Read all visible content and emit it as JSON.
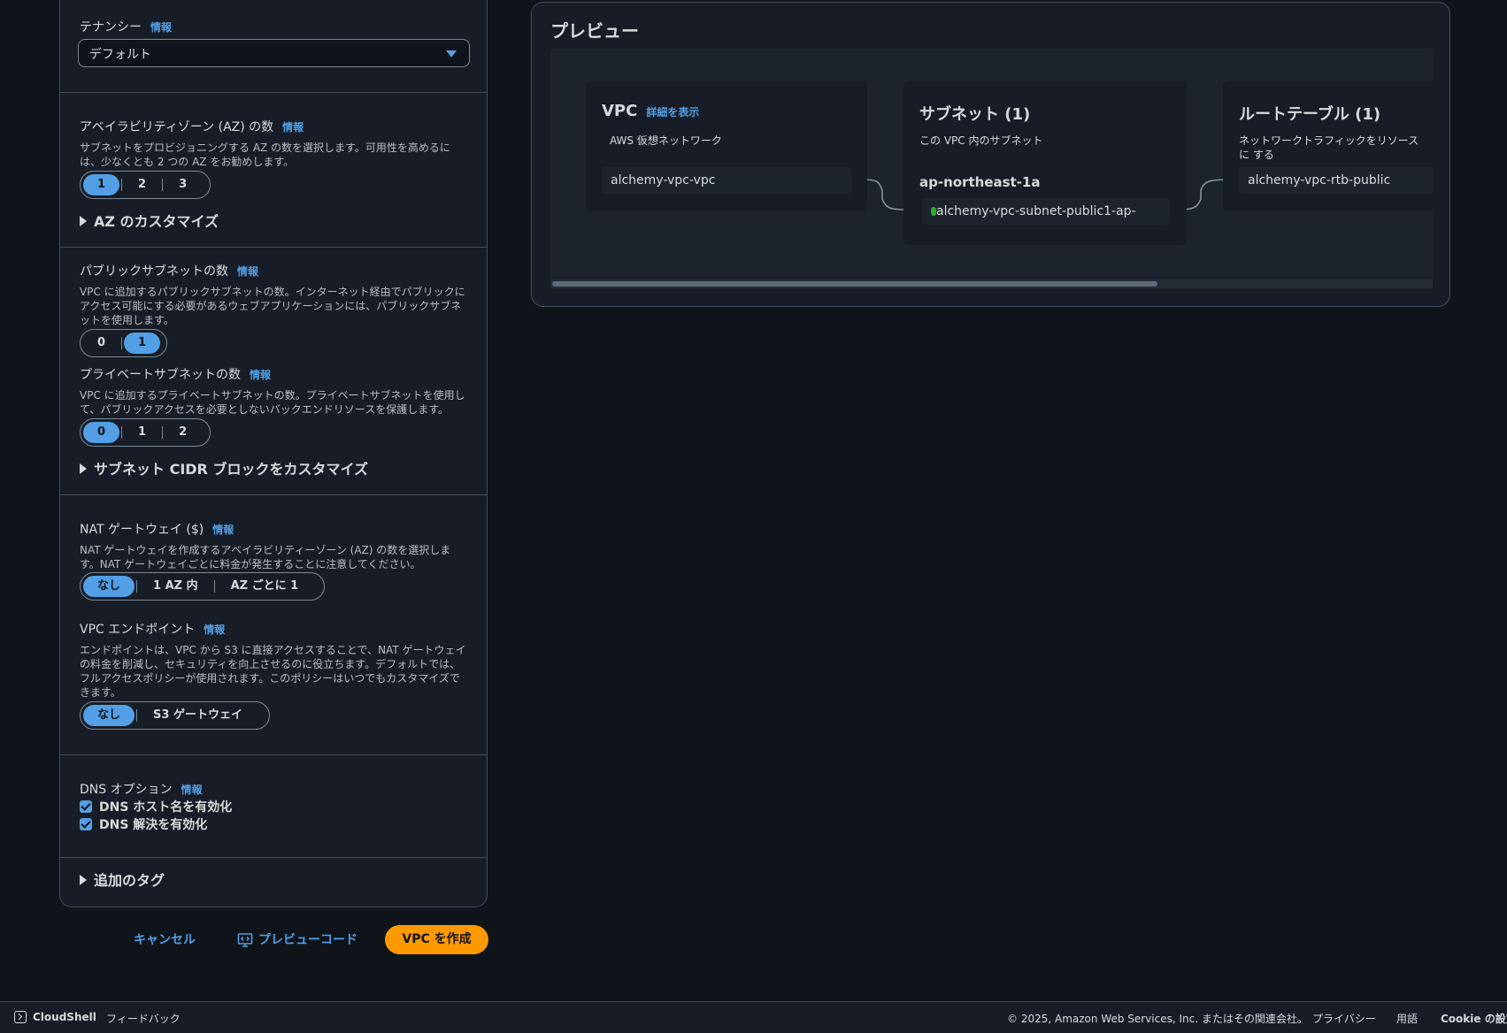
{
  "tenancy": {
    "label": "テナンシー",
    "info": "情報",
    "value": "デフォルト"
  },
  "az_count": {
    "label_prefix": "アベイラビリティゾーン (AZ) ",
    "label_suffix": "の数",
    "info": "情報",
    "description": "サブネットをプロビジョニングする AZ の数を選択します。可用性を高めるには、少なくとも 2 つの AZ をお勧めします。",
    "options": [
      "1",
      "2",
      "3"
    ],
    "selected": "1",
    "customize": "AZ のカスタマイズ"
  },
  "public_subnets": {
    "label": "パブリックサブネットの数",
    "info": "情報",
    "description": "VPC に追加するパブリックサブネットの数。インターネット経由でパブリックにアクセス可能にする必要があるウェブアプリケーションには、パブリックサブネットを使用します。",
    "options": [
      "0",
      "1"
    ],
    "selected": "1"
  },
  "private_subnets": {
    "label": "プライベートサブネットの数",
    "info": "情報",
    "description": "VPC に追加するプライベートサブネットの数。プライベートサブネットを使用して、パブリックアクセスを必要としないバックエンドリソースを保護します。",
    "options": [
      "0",
      "1",
      "2"
    ],
    "selected": "0",
    "customize": "サブネット CIDR ブロックをカスタマイズ"
  },
  "nat": {
    "label": "NAT ゲートウェイ ($)",
    "info": "情報",
    "description": "NAT ゲートウェイを作成するアベイラビリティーゾーン (AZ) の数を選択します。NAT ゲートウェイごとに料金が発生することに注意してください。",
    "options": [
      "なし",
      "1 AZ 内",
      "AZ ごとに 1"
    ],
    "selected": "なし"
  },
  "endpoint": {
    "label": "VPC エンドポイント",
    "info": "情報",
    "description": "エンドポイントは、VPC から S3 に直接アクセスすることで、NAT ゲートウェイの料金を削減し、セキュリティを向上させるのに役立ちます。デフォルトでは、フルアクセスポリシーが使用されます。このポリシーはいつでもカスタマイズできます。",
    "options": [
      "なし",
      "S3 ゲートウェイ"
    ],
    "selected": "なし"
  },
  "dns": {
    "label": "DNS オプション",
    "info": "情報",
    "hostnames": "DNS ホスト名を有効化",
    "resolution": "DNS 解決を有効化"
  },
  "tags": {
    "label": "追加のタグ"
  },
  "actions": {
    "cancel": "キャンセル",
    "preview_code": "プレビューコード",
    "create": "VPC を作成"
  },
  "preview": {
    "title": "プレビュー",
    "vpc": {
      "title": "VPC",
      "details_link": "詳細を表示",
      "subtitle": "AWS 仮想ネットワーク",
      "node": "alchemy-vpc-vpc"
    },
    "subnets": {
      "title": "サブネット (1)",
      "subtitle": "この VPC 内のサブネット",
      "az": "ap-northeast-1a",
      "node": "alchemy-vpc-subnet-public1-ap-"
    },
    "route_tables": {
      "title": "ルートテーブル (1)",
      "subtitle": "ネットワークトラフィックをリソースに する",
      "node": "alchemy-vpc-rtb-public"
    },
    "scroll_position": 0.0
  },
  "footer": {
    "cloudshell": "CloudShell",
    "feedback": "フィードバック",
    "copyright": "© 2025, Amazon Web Services, Inc. またはその関連会社。",
    "privacy": "プライバシー",
    "terms": "用語",
    "cookies": "Cookie の設定"
  },
  "colors": {
    "accent": "#539fe5",
    "primary": "#ff9900",
    "background": "#0f141a",
    "panel": "#161d26"
  }
}
